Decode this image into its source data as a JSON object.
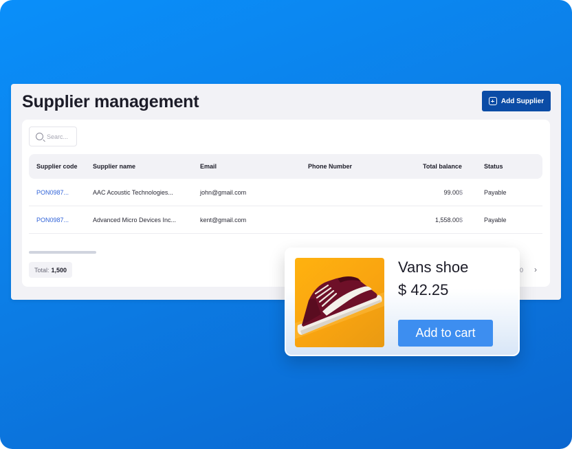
{
  "header": {
    "title": "Supplier management",
    "add_button_label": "Add Supplier"
  },
  "search": {
    "placeholder": "Searc..."
  },
  "table": {
    "columns": [
      "Supplier code",
      "Supplier name",
      "Email",
      "Phone Number",
      "Total balance",
      "Status"
    ],
    "rows": [
      {
        "code": "PON0987...",
        "name": "AAC Acoustic Technologies...",
        "email": "john@gmail.com",
        "phone": "",
        "balance": "99.00",
        "currency": "$",
        "status": "Payable"
      },
      {
        "code": "PON0987...",
        "name": "Advanced Micro Devices Inc...",
        "email": "kent@gmail.com",
        "phone": "",
        "balance": "1,558.00",
        "currency": "$",
        "status": "Payable"
      }
    ]
  },
  "footer": {
    "total_label": "Total:",
    "total_value": "1,500",
    "pager_partial": "0",
    "next_glyph": "›"
  },
  "product": {
    "name": "Vans shoe",
    "price": "$ 42.25",
    "cart_button_label": "Add to cart"
  },
  "colors": {
    "background_gradient": [
      "#0a8ffa",
      "#0a66cf"
    ],
    "primary_button": "#0b4ca6",
    "link": "#2f62d8",
    "cart_button": "#3d8ef0",
    "product_bg": "#f9a410",
    "shoe_body": "#6e1028"
  },
  "icons": {
    "add_button": "plus-square-icon",
    "search": "search-icon",
    "next_page": "chevron-right-icon"
  }
}
